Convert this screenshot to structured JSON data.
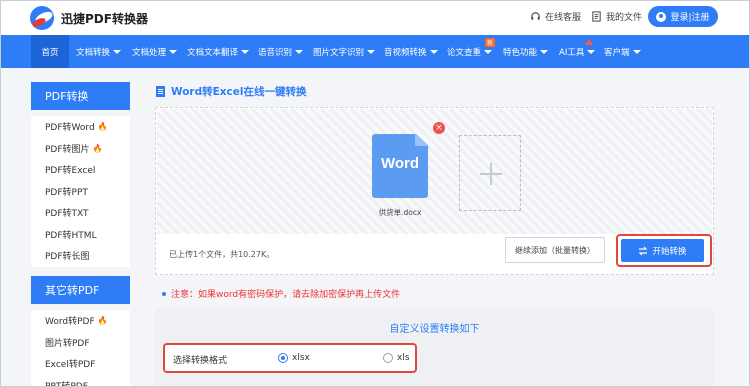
{
  "header": {
    "brand": "迅捷PDF转换器",
    "service_label": "在线客服",
    "files_label": "我的文件",
    "login_label": "登录|注册"
  },
  "nav": {
    "items": [
      {
        "label": "首页"
      },
      {
        "label": "文档转换"
      },
      {
        "label": "文档处理"
      },
      {
        "label": "文档文本翻译"
      },
      {
        "label": "语音识别"
      },
      {
        "label": "图片文字识别"
      },
      {
        "label": "音视频转换"
      },
      {
        "label": "论文查重"
      },
      {
        "label": "特色功能"
      },
      {
        "label": "AI工具"
      },
      {
        "label": "客户端"
      }
    ],
    "new_badge": "新"
  },
  "sidebar": {
    "group1_title": "PDF转换",
    "group1_items": [
      {
        "label": "PDF转Word",
        "hot": true
      },
      {
        "label": "PDF转图片",
        "hot": true
      },
      {
        "label": "PDF转Excel"
      },
      {
        "label": "PDF转PPT"
      },
      {
        "label": "PDF转TXT"
      },
      {
        "label": "PDF转HTML"
      },
      {
        "label": "PDF转长图"
      }
    ],
    "group2_title": "其它转PDF",
    "group2_items": [
      {
        "label": "Word转PDF",
        "hot": true
      },
      {
        "label": "图片转PDF"
      },
      {
        "label": "Excel转PDF"
      },
      {
        "label": "PPT转PDF"
      }
    ]
  },
  "main": {
    "section_title": "Word转Excel在线一键转换",
    "file": {
      "icon_label": "Word",
      "name": "供货单.docx"
    },
    "status": "已上传1个文件，共10.27K。",
    "continue_button": "继续添加（批量转换）",
    "start_button": "开始转换",
    "notice": "注意：如果word有密码保护，请去除加密保护再上传文件",
    "settings_title": "自定义设置转换如下",
    "format_label": "选择转换格式",
    "options": [
      {
        "label": "xlsx",
        "selected": true
      },
      {
        "label": "xls",
        "selected": false
      }
    ]
  },
  "colors": {
    "accent": "#2f7df6",
    "highlight": "#e0493a",
    "notice": "#ee3333"
  }
}
